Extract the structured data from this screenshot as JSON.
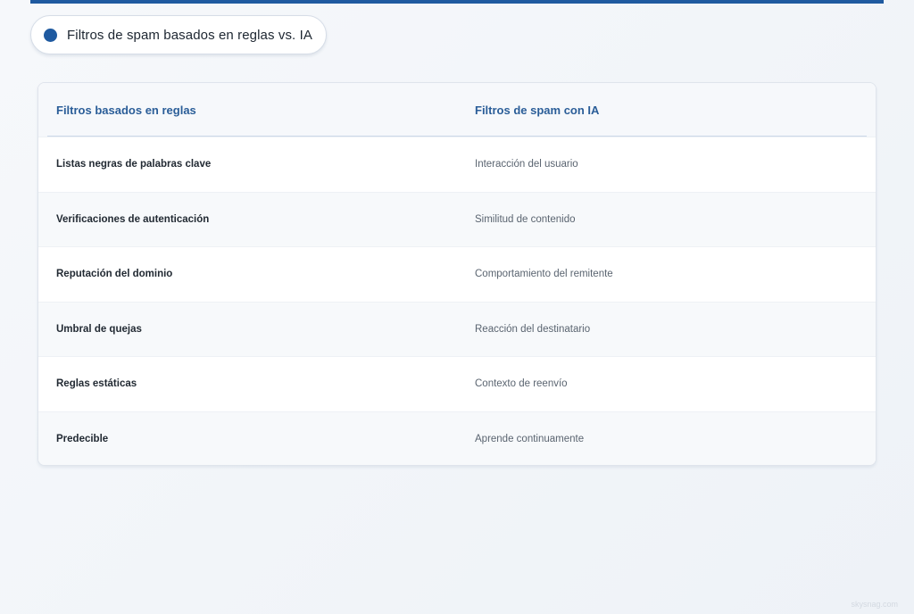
{
  "title": "Filtros de spam basados en reglas vs. IA",
  "table": {
    "headers": [
      "Filtros basados en reglas",
      "Filtros de spam con IA"
    ],
    "rows": [
      [
        "Listas negras de palabras clave",
        "Interacción del usuario"
      ],
      [
        "Verificaciones de autenticación",
        "Similitud de contenido"
      ],
      [
        "Reputación del dominio",
        "Comportamiento del remitente"
      ],
      [
        "Umbral de quejas",
        "Reacción del destinatario"
      ],
      [
        "Reglas estáticas",
        "Contexto de reenvío"
      ],
      [
        "Predecible",
        "Aprende continuamente"
      ]
    ]
  },
  "watermark": "skysnag.com",
  "colors": {
    "accent": "#1f5aa0",
    "header_text": "#2a5d98"
  }
}
